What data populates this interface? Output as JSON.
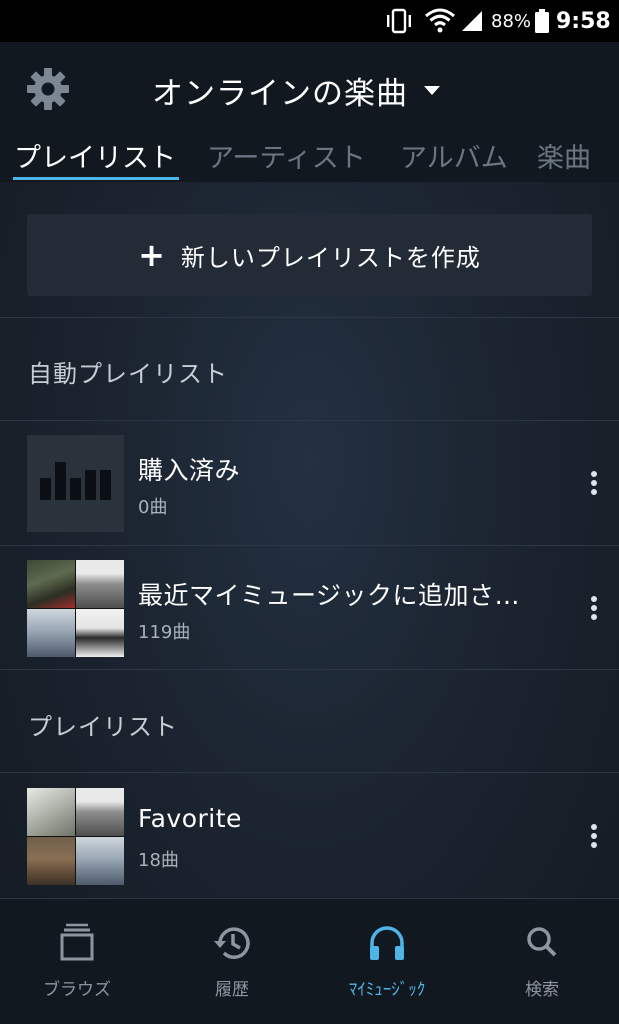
{
  "status_bar": {
    "battery_percent": "88%",
    "time": "9:58",
    "icons": [
      "vibrate-icon",
      "wifi-icon",
      "signal-icon",
      "battery-icon"
    ]
  },
  "header": {
    "title": "オンラインの楽曲",
    "settings_icon": "gear-icon",
    "dropdown_icon": "caret-down-icon"
  },
  "tabs": [
    {
      "label": "プレイリスト",
      "active": true
    },
    {
      "label": "アーティスト",
      "active": false
    },
    {
      "label": "アルバム",
      "active": false
    },
    {
      "label": "楽曲",
      "active": false
    }
  ],
  "create_button": {
    "label": "新しいプレイリストを作成",
    "icon": "plus-icon"
  },
  "sections": {
    "auto_title": "自動プレイリスト",
    "playlist_title": "プレイリスト"
  },
  "auto_playlists": [
    {
      "title": "購入済み",
      "count": "0曲",
      "thumb": "equalizer"
    },
    {
      "title": "最近マイミュージックに追加さ…",
      "count": "119曲",
      "thumb": "mosaic"
    }
  ],
  "playlists": [
    {
      "title": "Favorite",
      "count": "18曲",
      "thumb": "mosaic"
    }
  ],
  "bottom_nav": [
    {
      "label": "ブラウズ",
      "icon": "browse-icon",
      "active": false
    },
    {
      "label": "履歴",
      "icon": "history-icon",
      "active": false
    },
    {
      "label": "ﾏｲﾐｭｰｼﾞｯｸ",
      "icon": "headphones-icon",
      "active": true
    },
    {
      "label": "検索",
      "icon": "search-icon",
      "active": false
    }
  ],
  "colors": {
    "accent": "#4fb4e6",
    "background": "#1a212b",
    "inactive_text": "#6b7683"
  }
}
